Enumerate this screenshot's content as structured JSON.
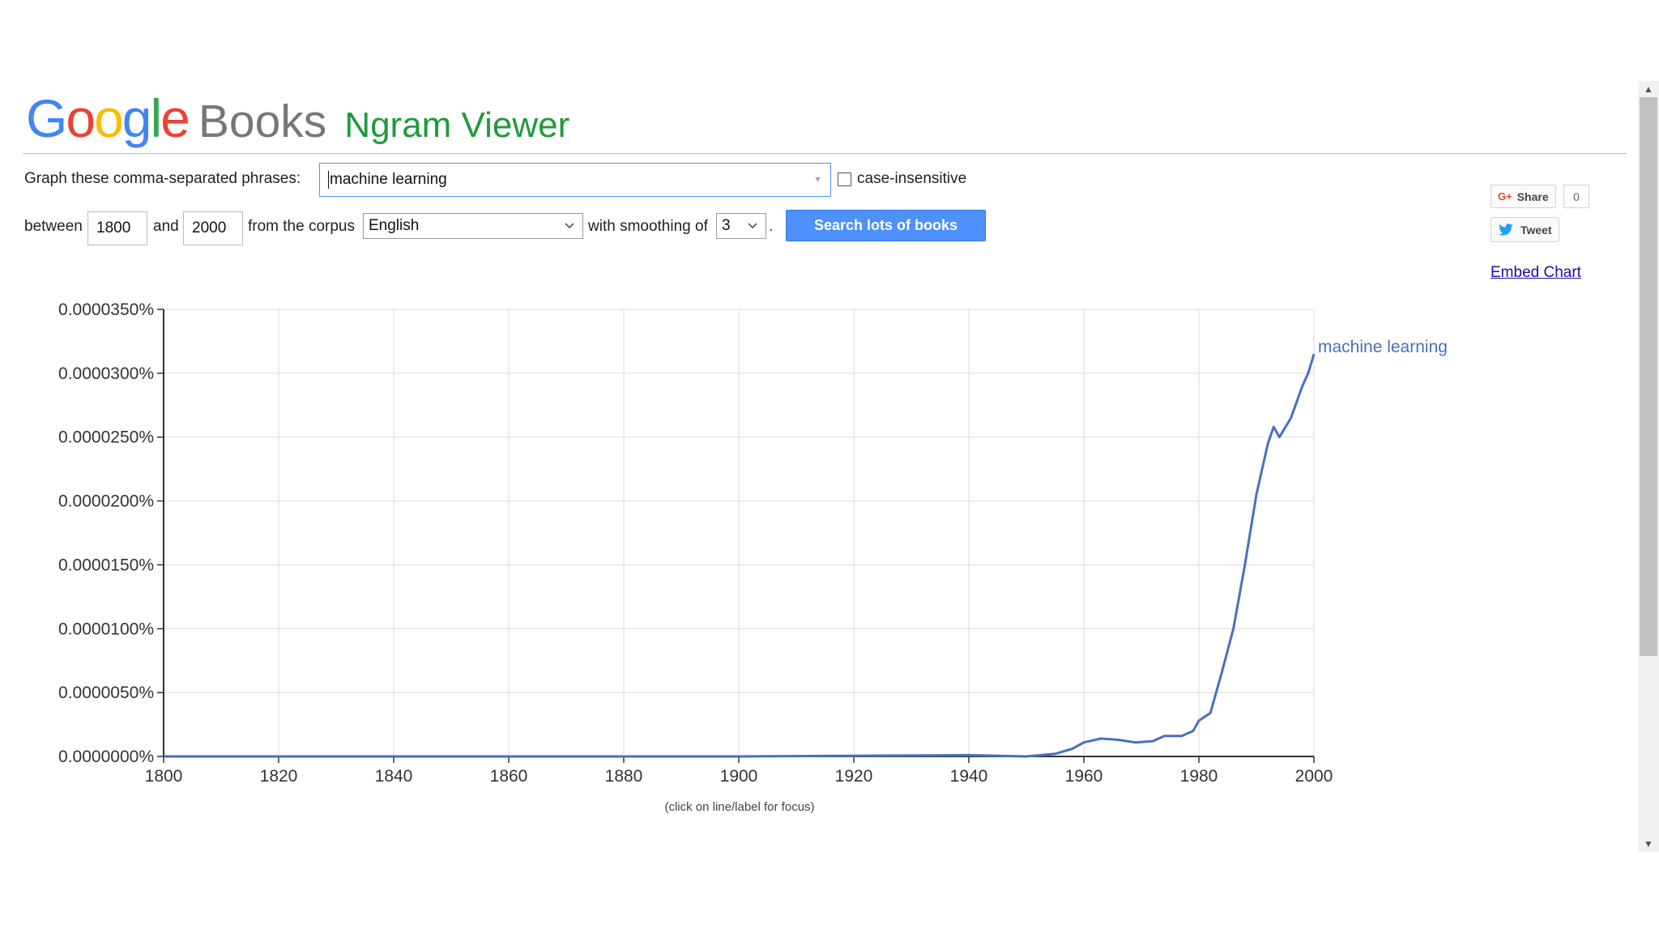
{
  "header": {
    "logo_google_letters": [
      {
        "ch": "G",
        "color": "#4285f4"
      },
      {
        "ch": "o",
        "color": "#ea4335"
      },
      {
        "ch": "o",
        "color": "#fbbc05"
      },
      {
        "ch": "g",
        "color": "#4285f4"
      },
      {
        "ch": "l",
        "color": "#34a853"
      },
      {
        "ch": "e",
        "color": "#ea4335"
      }
    ],
    "logo_books": "Books",
    "app_title": "Ngram Viewer"
  },
  "form": {
    "phrases_label": "Graph these comma-separated phrases:",
    "phrases_value": "machine learning",
    "case_insensitive_label": "case-insensitive",
    "case_insensitive_checked": false,
    "between_label": "between",
    "start_year": "1800",
    "and_label": "and",
    "end_year": "2000",
    "corpus_label": "from the corpus",
    "corpus_value": "English",
    "smoothing_label": "with smoothing of",
    "smoothing_value": "3",
    "period": ".",
    "search_button": "Search lots of books"
  },
  "social": {
    "share_label": "Share",
    "share_count": "0",
    "tweet_label": "Tweet",
    "embed_label": "Embed Chart"
  },
  "colors": {
    "series": "#4a6fc0",
    "search_button": "#4d90fe",
    "app_title": "#1f9a3c"
  },
  "chart_data": {
    "type": "line",
    "xlim": [
      1800,
      2000
    ],
    "ylim": [
      0,
      3.5e-05
    ],
    "x_ticks": [
      "1800",
      "1820",
      "1840",
      "1860",
      "1880",
      "1900",
      "1920",
      "1940",
      "1960",
      "1980",
      "2000"
    ],
    "y_ticks": [
      "0.0000000%",
      "0.0000050%",
      "0.0000100%",
      "0.0000150%",
      "0.0000200%",
      "0.0000250%",
      "0.0000300%",
      "0.0000350%"
    ],
    "y_tick_values": [
      0,
      5e-06,
      1e-05,
      1.5e-05,
      2e-05,
      2.5e-05,
      3e-05,
      3.5e-05
    ],
    "footnote": "(click on line/label for focus)",
    "grid": true,
    "series": [
      {
        "name": "machine learning",
        "points": [
          [
            1800,
            0
          ],
          [
            1900,
            0
          ],
          [
            1940,
            1e-07
          ],
          [
            1950,
            0
          ],
          [
            1955,
            2e-07
          ],
          [
            1958,
            6e-07
          ],
          [
            1960,
            1.1e-06
          ],
          [
            1963,
            1.4e-06
          ],
          [
            1966,
            1.3e-06
          ],
          [
            1969,
            1.1e-06
          ],
          [
            1972,
            1.2e-06
          ],
          [
            1974,
            1.6e-06
          ],
          [
            1977,
            1.6e-06
          ],
          [
            1979,
            2e-06
          ],
          [
            1980,
            2.8e-06
          ],
          [
            1982,
            3.4e-06
          ],
          [
            1984,
            6.6e-06
          ],
          [
            1986,
            1e-05
          ],
          [
            1988,
            1.5e-05
          ],
          [
            1990,
            2.05e-05
          ],
          [
            1992,
            2.45e-05
          ],
          [
            1993,
            2.58e-05
          ],
          [
            1994,
            2.5e-05
          ],
          [
            1996,
            2.65e-05
          ],
          [
            1998,
            2.9e-05
          ],
          [
            1999,
            3e-05
          ],
          [
            2000,
            3.15e-05
          ]
        ]
      }
    ]
  }
}
